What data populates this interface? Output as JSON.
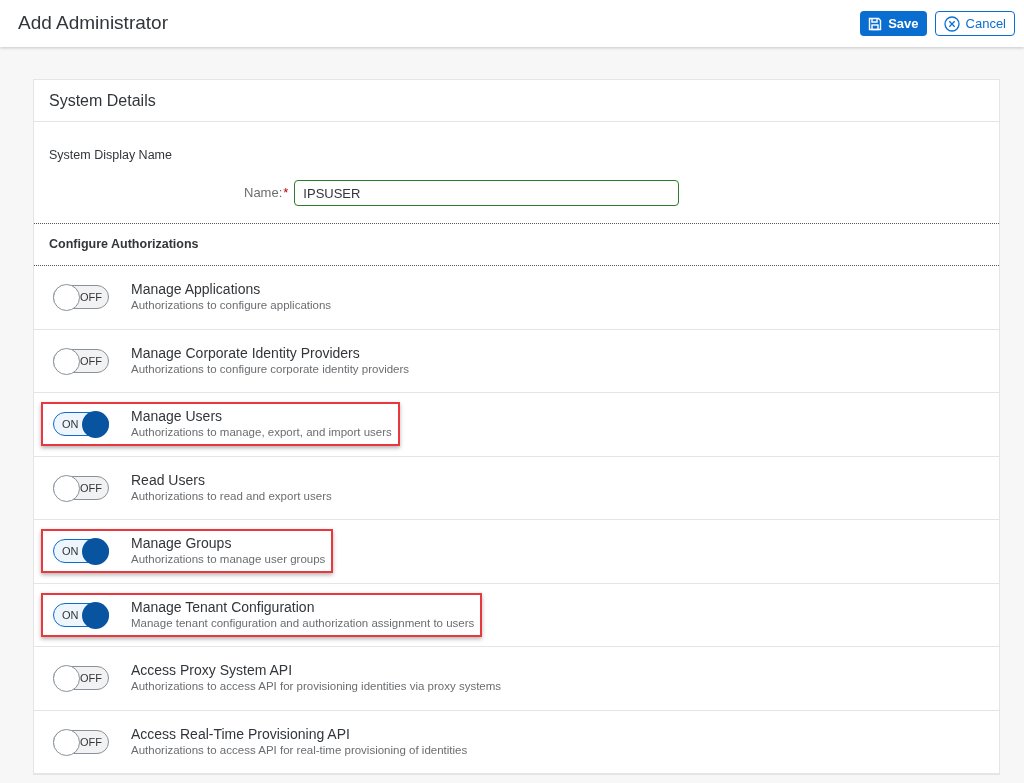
{
  "header": {
    "title": "Add Administrator",
    "buttons": [
      {
        "kind": "save",
        "label": "Save"
      },
      {
        "kind": "cancel",
        "label": "Cancel"
      }
    ]
  },
  "system_details": {
    "title": "System Details",
    "subtitle": "System Display Name",
    "name_field": {
      "label": "Name:",
      "required_mark": "*",
      "value": "IPSUSER"
    }
  },
  "authorizations": {
    "title": "Configure Authorizations",
    "items": [
      {
        "title": "Manage Applications",
        "description": "Authorizations to configure applications",
        "on": false,
        "switch_text": "OFF",
        "highlighted": false
      },
      {
        "title": "Manage Corporate Identity Providers",
        "description": "Authorizations to configure corporate identity providers",
        "on": false,
        "switch_text": "OFF",
        "highlighted": false
      },
      {
        "title": "Manage Users",
        "description": "Authorizations to manage, export, and import users",
        "on": true,
        "switch_text": "ON",
        "highlighted": true
      },
      {
        "title": "Read Users",
        "description": "Authorizations to read and export users",
        "on": false,
        "switch_text": "OFF",
        "highlighted": false
      },
      {
        "title": "Manage Groups",
        "description": "Authorizations to manage user groups",
        "on": true,
        "switch_text": "ON",
        "highlighted": true
      },
      {
        "title": "Manage Tenant Configuration",
        "description": "Manage tenant configuration and authorization assignment to users",
        "on": true,
        "switch_text": "ON",
        "highlighted": true
      },
      {
        "title": "Access Proxy System API",
        "description": "Authorizations to access API for provisioning identities via proxy systems",
        "on": false,
        "switch_text": "OFF",
        "highlighted": false
      },
      {
        "title": "Access Real-Time Provisioning API",
        "description": "Authorizations to access API for real-time provisioning of identities",
        "on": false,
        "switch_text": "OFF",
        "highlighted": false
      }
    ]
  }
}
